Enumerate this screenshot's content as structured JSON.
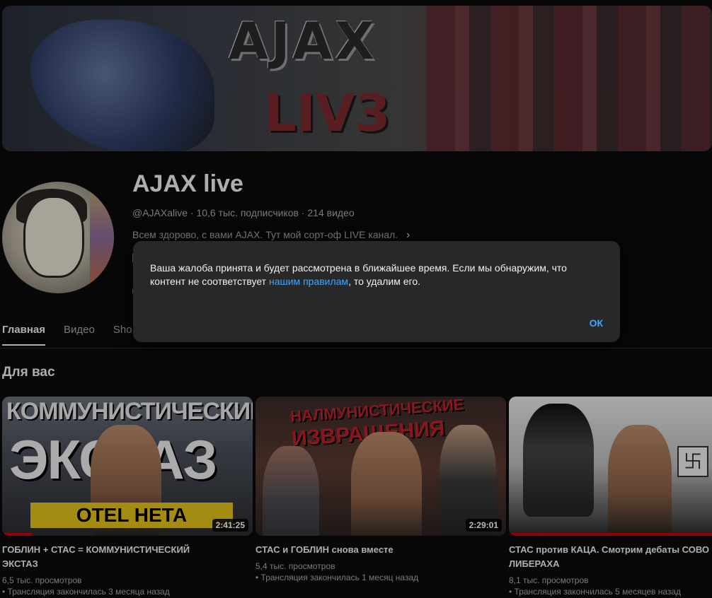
{
  "banner": {
    "logo_line1": "AJAX",
    "logo_line2": "LIV3"
  },
  "channel": {
    "name": "AJAX live",
    "meta": "@AJAXalive · 10,6 тыс. подписчиков · 214 видео",
    "description": "Всем здорово, с вами AJAX. Тут мой сорт-оф LIVE канал."
  },
  "tabs": [
    {
      "label": "Главная",
      "active": true
    },
    {
      "label": "Видео"
    },
    {
      "label": "Sho"
    }
  ],
  "section": {
    "title": "Для вас"
  },
  "videos": [
    {
      "thumb_text1": "КОММУНИСТИЧЕСКИЙ",
      "thumb_text2": "ЭКСТАЗ",
      "thumb_text3": "OTEL  НЕТА",
      "duration": "2:41:25",
      "title_line1": "ГОБЛИН + СТАС = КОММУНИСТИЧЕСКИЙ",
      "title_line2": "ЭКСТАЗ",
      "views": "6,5 тыс. просмотров",
      "status": "• Трансляция закончилась 3 месяца назад",
      "progress": 0.12
    },
    {
      "thumb_text1": "НАЛМУНИСТИЧЕСКИЕ",
      "thumb_text2": "ИЗВРАЩЕНИЯ",
      "duration": "2:29:01",
      "title_line1": "СТАС и ГОБЛИН снова вместе",
      "views": "5,4 тыс. просмотров",
      "status": "• Трансляция закончилась 1 месяц назад",
      "progress": 0.0
    },
    {
      "title_line1": "СТАС против КАЦА. Смотрим дебаты СОВО",
      "title_line2": "ЛИБЕРАХА",
      "views": "8,1 тыс. просмотров",
      "status": "• Трансляция закончилась 5 месяцев назад",
      "progress": 1.0
    }
  ],
  "dialog": {
    "text_before": "Ваша жалоба принята и будет рассмотрена в ближайшее время. Если мы обнаружим, что контент не соответствует ",
    "link_text": "нашим правилам",
    "text_after": ", то удалим его.",
    "ok_label": "ОК"
  },
  "colors": {
    "accent": "#3ea6ff",
    "background": "#0f0f0f",
    "dialog": "#282828",
    "progress": "#cc0000"
  }
}
